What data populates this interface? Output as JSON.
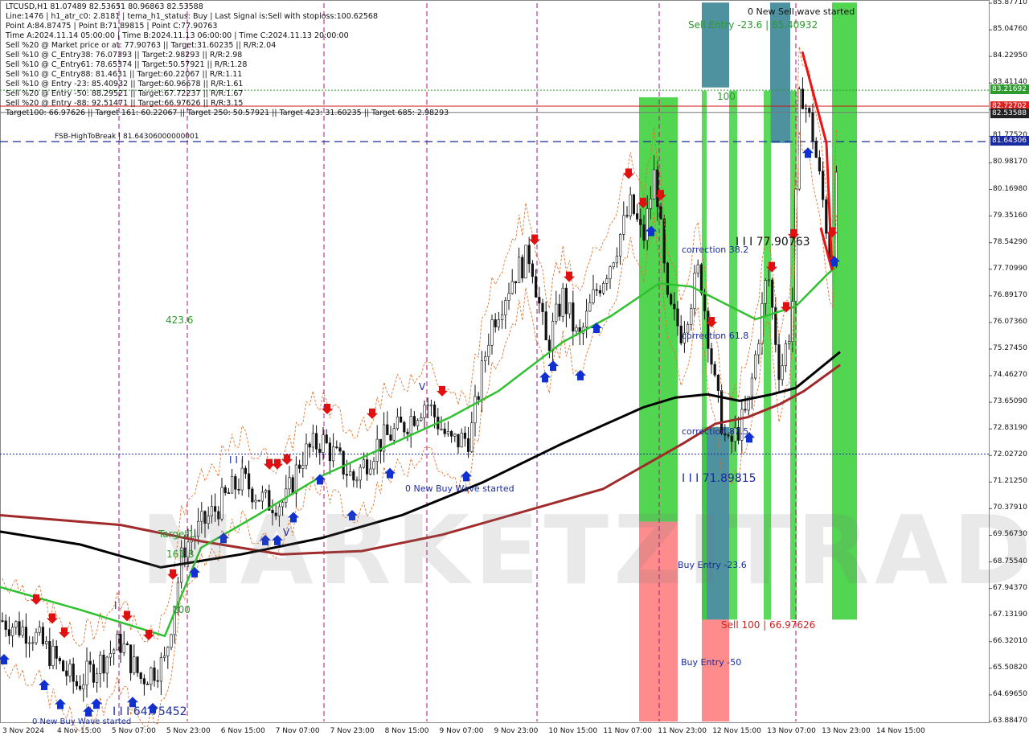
{
  "colors": {
    "bull": "#2e8b2e",
    "bear": "#1a1a1a",
    "ema_green": "#2fc12f",
    "ema_black": "#000000",
    "ema_red": "#a12a2a",
    "zone_green": "#3fd23f",
    "zone_red": "#ff7f7f",
    "zone_teal": "#2f7f8f",
    "blue_line": "#1a2aa0",
    "red_line": "#cc1111",
    "magenta": "#b0107a"
  },
  "header": {
    "lines": [
      "LTCUSD,H1  81.07489 82.53651 80.96863 82.53588",
      "Line:1476  |  h1_atr_c0: 2.8181  |  tema_h1_status: Buy  |  Last Signal is:Sell with stoploss:100.62568",
      "Point A:84.87475  |  Point B:71.89815  |  Point C:77.90763",
      "Time A:2024.11.14 05:00:00  |  Time B:2024.11.13 06:00:00  |  Time C:2024.11.13 20:00:00",
      "Sell %20 @ Market price or at: 77.90763  ||  Target:31.60235  ||  R/R:2.04",
      "Sell %10 @ C_Entry38: 76.07393  ||  Target:2.98293  ||  R/R:2.98",
      "Sell %10 @ C_Entry61: 78.65374  ||  Target:50.57921  ||  R/R:1.28",
      "Sell %10 @ C_Entry88: 81.4631  ||  Target:60.22067  ||  R/R:1.11",
      "Sell %10 @ Entry -23: 85.40932  ||  Target:60.96678  ||  R/R:1.61",
      "Sell %20 @ Entry -50: 88.29521  ||  Target:67.72237  ||  R/R:1.67",
      "Sell %20 @ Entry -88: 92.51471  ||  Target:66.97626  ||  R/R:3.15",
      "Target100: 66.97626  ||  Target 161: 60.22067  ||  Target 250: 50.57921  ||  Target 423: 31.60235  ||  Target 685: 2.98293"
    ]
  },
  "labels": {
    "fsb": "FSB-HighToBreak  |  81.64306000000001",
    "new_sell_wave": "0 New Sell wave started",
    "sell_entry": "Sell Entry -23.6 | 85.40932",
    "hundred_top": "100",
    "point_c": "I I I 77.90763",
    "correction38": "correction 38.2",
    "correction61": "correction 61.8",
    "correction87": "correction 87.5",
    "point_b": "I I I 71.89815",
    "buy_entry_23": "Buy Entry -23.6",
    "sell100": "Sell 100 | 66.97626",
    "buy_entry_50": "Buy Entry -50",
    "new_buy_wave_mid": "0 New Buy Wave started",
    "new_buy_wave_low": "0 New Buy Wave started",
    "point_low": "I I I 64.75452",
    "fib423": "423.6",
    "target1": "Target1",
    "fib161": "161.8",
    "fib100": "100",
    "iii_left": "I I I",
    "v_mark_1": "V",
    "v_mark_2": "V",
    "i_mark": "I"
  },
  "watermark": "MARKETZITRADE",
  "price_boxes": {
    "green": "83.21692",
    "red": "82.72702",
    "dark": "82.53588",
    "blue": "81.64306"
  },
  "chart_data": {
    "type": "candlestick",
    "symbol": "LTCUSD",
    "timeframe": "H1",
    "ylim": [
      63.88,
      85.88
    ],
    "yticks": [
      "85.87710",
      "85.04760",
      "84.22950",
      "83.41140",
      "82.59330",
      "81.77520",
      "80.98170",
      "80.16980",
      "79.35160",
      "78.54290",
      "77.70990",
      "76.89170",
      "76.07360",
      "75.27450",
      "74.46270",
      "73.65090",
      "72.83190",
      "72.02720",
      "71.21250",
      "70.37910",
      "69.56730",
      "68.75540",
      "67.94370",
      "67.13190",
      "66.32010",
      "65.50820",
      "64.69650",
      "63.88470"
    ],
    "xlabels": [
      "3 Nov 2024",
      "4 Nov 15:00",
      "5 Nov 07:00",
      "5 Nov 23:00",
      "6 Nov 15:00",
      "7 Nov 07:00",
      "7 Nov 23:00",
      "8 Nov 15:00",
      "9 Nov 07:00",
      "9 Nov 23:00",
      "10 Nov 15:00",
      "11 Nov 07:00",
      "11 Nov 23:00",
      "12 Nov 15:00",
      "13 Nov 07:00",
      "13 Nov 23:00",
      "14 Nov 15:00"
    ],
    "keypoints": [
      [
        0,
        67.0
      ],
      [
        40,
        66.6
      ],
      [
        95,
        65.0
      ],
      [
        150,
        66.3
      ],
      [
        175,
        65.2
      ],
      [
        205,
        65.7
      ],
      [
        228,
        69.2
      ],
      [
        255,
        70.0
      ],
      [
        300,
        71.3
      ],
      [
        330,
        70.6
      ],
      [
        355,
        70.6
      ],
      [
        375,
        72.0
      ],
      [
        400,
        72.5
      ],
      [
        440,
        71.3
      ],
      [
        470,
        72.4
      ],
      [
        500,
        72.9
      ],
      [
        530,
        73.7
      ],
      [
        560,
        72.4
      ],
      [
        585,
        72.6
      ],
      [
        610,
        76.0
      ],
      [
        640,
        77.6
      ],
      [
        660,
        78.2
      ],
      [
        680,
        75.3
      ],
      [
        700,
        76.9
      ],
      [
        720,
        75.5
      ],
      [
        740,
        77.0
      ],
      [
        760,
        78.0
      ],
      [
        785,
        79.7
      ],
      [
        800,
        78.6
      ],
      [
        815,
        80.8
      ],
      [
        830,
        76.6
      ],
      [
        848,
        75.8
      ],
      [
        870,
        77.8
      ],
      [
        890,
        74.0
      ],
      [
        905,
        72.2
      ],
      [
        930,
        73.4
      ],
      [
        955,
        77.7
      ],
      [
        970,
        74.5
      ],
      [
        985,
        76.2
      ],
      [
        995,
        83.4
      ],
      [
        1010,
        82.0
      ],
      [
        1025,
        79.6
      ],
      [
        1035,
        77.7
      ],
      [
        1045,
        82.5
      ]
    ],
    "ema_green": [
      [
        0,
        68.0
      ],
      [
        100,
        67.3
      ],
      [
        205,
        66.5
      ],
      [
        250,
        69.2
      ],
      [
        320,
        70.2
      ],
      [
        400,
        71.4
      ],
      [
        480,
        72.3
      ],
      [
        560,
        73.2
      ],
      [
        620,
        74.0
      ],
      [
        700,
        75.5
      ],
      [
        760,
        76.3
      ],
      [
        820,
        77.3
      ],
      [
        860,
        77.2
      ],
      [
        900,
        76.7
      ],
      [
        940,
        76.2
      ],
      [
        990,
        76.6
      ],
      [
        1030,
        77.6
      ],
      [
        1040,
        77.8
      ]
    ],
    "ema_black": [
      [
        0,
        69.7
      ],
      [
        100,
        69.3
      ],
      [
        200,
        68.6
      ],
      [
        300,
        69.0
      ],
      [
        400,
        69.5
      ],
      [
        500,
        70.2
      ],
      [
        600,
        71.2
      ],
      [
        700,
        72.4
      ],
      [
        800,
        73.5
      ],
      [
        840,
        73.8
      ],
      [
        880,
        73.9
      ],
      [
        920,
        73.7
      ],
      [
        960,
        73.9
      ],
      [
        990,
        74.1
      ],
      [
        1045,
        75.2
      ]
    ],
    "ema_red": [
      [
        0,
        70.2
      ],
      [
        150,
        69.9
      ],
      [
        250,
        69.4
      ],
      [
        350,
        69.0
      ],
      [
        450,
        69.1
      ],
      [
        550,
        69.6
      ],
      [
        650,
        70.3
      ],
      [
        750,
        71.0
      ],
      [
        800,
        71.7
      ],
      [
        850,
        72.4
      ],
      [
        890,
        73.0
      ],
      [
        930,
        73.2
      ],
      [
        970,
        73.6
      ],
      [
        1000,
        74.0
      ],
      [
        1045,
        74.8
      ]
    ],
    "levels": {
      "green_dotted": 83.21692,
      "red_line": 82.72702,
      "gray_line": 82.53588,
      "blue_dashed": 81.64306,
      "blue_dotted": 72.07
    },
    "magenta_time_lines": [
      148,
      233,
      403,
      531,
      668,
      820,
      990
    ],
    "zones": [
      {
        "x": 795,
        "w": 48,
        "top": 83.0,
        "bottom": 70.0,
        "color": "green"
      },
      {
        "x": 795,
        "w": 48,
        "top": 70.0,
        "bottom": 63.88,
        "color": "red"
      },
      {
        "x": 873,
        "w": 34,
        "top": 85.9,
        "bottom": 83.3,
        "color": "teal"
      },
      {
        "x": 873,
        "w": 34,
        "top": 72.9,
        "bottom": 67.0,
        "color": "teal"
      },
      {
        "x": 873,
        "w": 34,
        "top": 67.0,
        "bottom": 63.88,
        "color": "red"
      },
      {
        "x": 958,
        "w": 25,
        "top": 85.9,
        "bottom": 81.6,
        "color": "teal"
      },
      {
        "x": 1035,
        "w": 31,
        "top": 85.9,
        "bottom": 67.0,
        "color": "green"
      }
    ],
    "sell_arrows_x": [
      45,
      65,
      80,
      158,
      185,
      215,
      335,
      345,
      357,
      407,
      463,
      550,
      665,
      708,
      782,
      800,
      822,
      885,
      960,
      978,
      987,
      1035
    ],
    "buy_arrows_x": [
      5,
      55,
      75,
      110,
      120,
      165,
      190,
      242,
      278,
      330,
      345,
      365,
      398,
      438,
      485,
      580,
      678,
      688,
      722,
      742,
      810,
      932,
      1038,
      1005
    ]
  }
}
